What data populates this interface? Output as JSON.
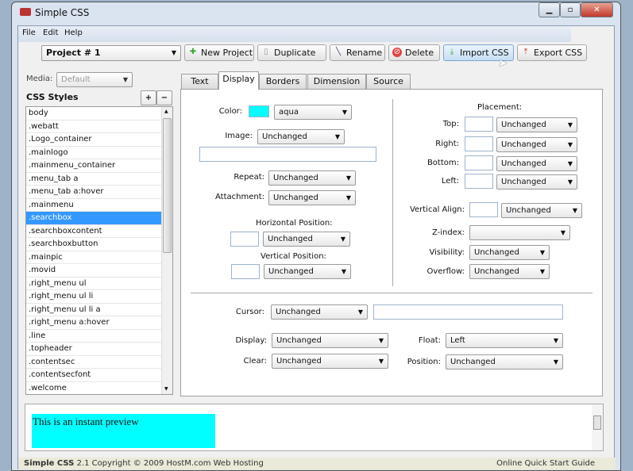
{
  "window": {
    "title": "Simple CSS",
    "controls": [
      "minimize",
      "maximize",
      "close"
    ]
  },
  "menu": [
    "File",
    "Edit",
    "Help"
  ],
  "toolbar": {
    "project": "Project # 1",
    "buttons": [
      {
        "label": "New Project",
        "icon": "plus-icon"
      },
      {
        "label": "Duplicate",
        "icon": "document-icon"
      },
      {
        "label": "Rename",
        "icon": "pencil-icon"
      },
      {
        "label": "Delete",
        "icon": "delete-icon"
      },
      {
        "label": "Import CSS",
        "icon": "import-icon"
      },
      {
        "label": "Export CSS",
        "icon": "export-icon"
      }
    ]
  },
  "left": {
    "media_label": "Media:",
    "media_value": "Default",
    "styles_title": "CSS Styles",
    "add": "+",
    "remove": "−",
    "items": [
      "body",
      ".webatt",
      ".Logo_container",
      ".mainlogo",
      ".mainmenu_container",
      ".menu_tab a",
      ".menu_tab a:hover",
      ".mainmenu",
      ".searchbox",
      ".searchboxcontent",
      ".searchboxbutton",
      ".mainpic",
      ".movid",
      ".right_menu ul",
      ".right_menu ul li",
      ".right_menu ul li a",
      ".right_menu a:hover",
      ".line",
      ".topheader",
      ".contentsec",
      ".contentsecfont",
      ".welcome"
    ],
    "selected": ".searchbox"
  },
  "tabs": [
    "Text",
    "Display",
    "Borders",
    "Dimension",
    "Source"
  ],
  "active_tab": "Display",
  "display": {
    "color_label": "Color:",
    "color_value": "aqua",
    "color_swatch": "#00ffff",
    "image_label": "Image:",
    "image_value": "Unchanged",
    "image_path": "",
    "repeat_label": "Repeat:",
    "repeat_value": "Unchanged",
    "attachment_label": "Attachment:",
    "attachment_value": "Unchanged",
    "hpos_label": "Horizontal Position:",
    "hpos_value": "Unchanged",
    "vpos_label": "Vertical Position:",
    "vpos_value": "Unchanged",
    "placement_label": "Placement:",
    "top_label": "Top:",
    "top_value": "Unchanged",
    "right_label": "Right:",
    "right_value": "Unchanged",
    "bottom_label": "Bottom:",
    "bottom_value": "Unchanged",
    "left_label": "Left:",
    "left_value": "Unchanged",
    "valign_label": "Vertical Align:",
    "valign_value": "Unchanged",
    "zindex_label": "Z-index:",
    "zindex_value": "",
    "visibility_label": "Visibility:",
    "visibility_value": "Unchanged",
    "overflow_label": "Overflow:",
    "overflow_value": "Unchanged",
    "cursor_label": "Cursor:",
    "cursor_value": "Unchanged",
    "display_label": "Display:",
    "display_value": "Unchanged",
    "float_label": "Float:",
    "float_value": "Left",
    "clear_label": "Clear:",
    "clear_value": "Unchanged",
    "position_label": "Position:",
    "position_value": "Unchanged"
  },
  "preview": {
    "text": "This is an instant preview",
    "bg": "#00ffff"
  },
  "status": {
    "left_bold": "Simple CSS",
    "left_rest": "2.1 Copyright © 2009 HostM.com Web Hosting",
    "right": "Online Quick Start Guide"
  }
}
